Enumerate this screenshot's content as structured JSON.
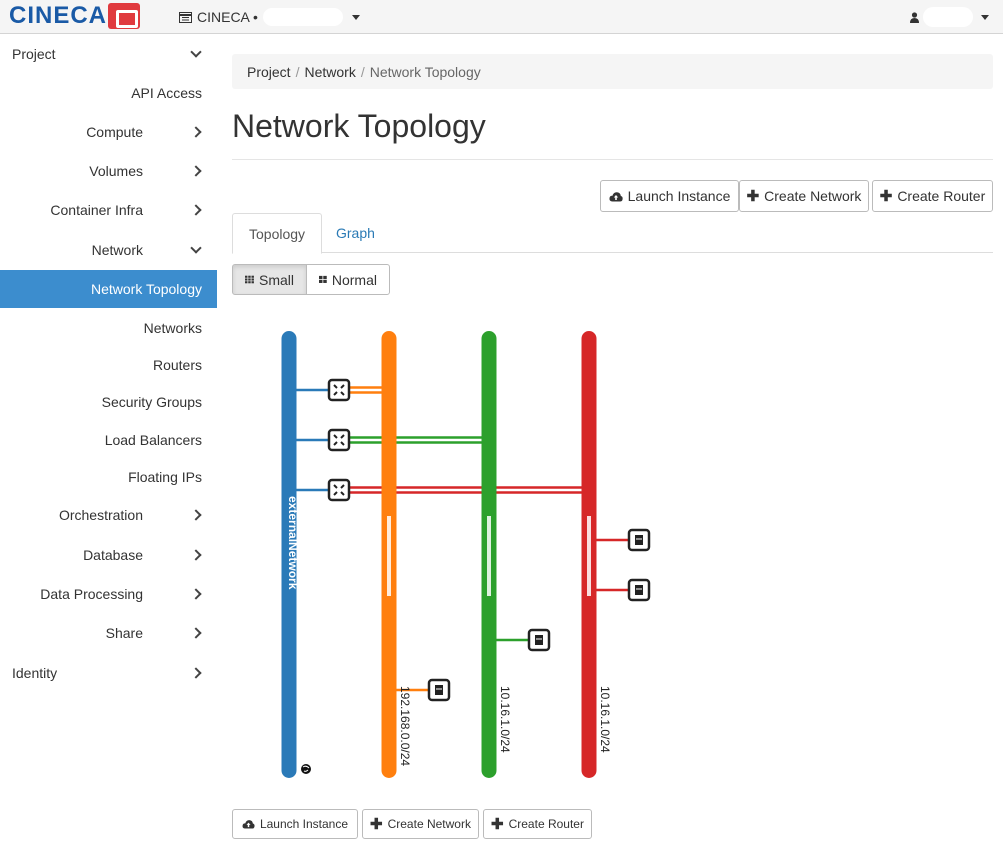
{
  "brand": {
    "name": "CINECA"
  },
  "project_switch": {
    "label": "CINECA •"
  },
  "sidebar": {
    "items": [
      {
        "label": "Project",
        "chevron": "down",
        "level": 0
      },
      {
        "label": "API Access",
        "chevron": null,
        "level": 1
      },
      {
        "label": "Compute",
        "chevron": "right",
        "level": 1
      },
      {
        "label": "Volumes",
        "chevron": "right",
        "level": 1
      },
      {
        "label": "Container Infra",
        "chevron": "right",
        "level": 1
      },
      {
        "label": "Network",
        "chevron": "down",
        "level": 1
      },
      {
        "label": "Network Topology",
        "chevron": null,
        "level": 2,
        "active": true
      },
      {
        "label": "Networks",
        "chevron": null,
        "level": 2
      },
      {
        "label": "Routers",
        "chevron": null,
        "level": 2
      },
      {
        "label": "Security Groups",
        "chevron": null,
        "level": 2
      },
      {
        "label": "Load Balancers",
        "chevron": null,
        "level": 2
      },
      {
        "label": "Floating IPs",
        "chevron": null,
        "level": 2
      },
      {
        "label": "Orchestration",
        "chevron": "right",
        "level": 1
      },
      {
        "label": "Database",
        "chevron": "right",
        "level": 1
      },
      {
        "label": "Data Processing",
        "chevron": "right",
        "level": 1
      },
      {
        "label": "Share",
        "chevron": "right",
        "level": 1
      },
      {
        "label": "Identity",
        "chevron": "right",
        "level": 0
      }
    ]
  },
  "breadcrumb": [
    "Project",
    "Network",
    "Network Topology"
  ],
  "page_title": "Network Topology",
  "actions": {
    "launch_instance": "Launch Instance",
    "create_network": "Create Network",
    "create_router": "Create Router"
  },
  "tabs": [
    {
      "label": "Topology",
      "active": true
    },
    {
      "label": "Graph",
      "active": false
    }
  ],
  "view_toggle": {
    "small": "Small",
    "normal": "Normal",
    "selected": "Small"
  },
  "topology": {
    "networks": [
      {
        "name": "externalNetwork",
        "color": "#2a7ab8",
        "cidr": "",
        "external": true
      },
      {
        "name": "",
        "color": "#ff7f0e",
        "cidr": "192.168.0.0/24"
      },
      {
        "name": "",
        "color": "#2ca02c",
        "cidr": "10.16.1.0/24"
      },
      {
        "name": "",
        "color": "#d62728",
        "cidr": "10.16.1.0/24"
      }
    ],
    "routers": [
      {
        "connects": [
          0,
          1
        ]
      },
      {
        "connects": [
          0,
          2
        ]
      },
      {
        "connects": [
          0,
          3
        ]
      }
    ],
    "instances": [
      {
        "network": 3
      },
      {
        "network": 3
      },
      {
        "network": 2
      },
      {
        "network": 1
      }
    ]
  }
}
